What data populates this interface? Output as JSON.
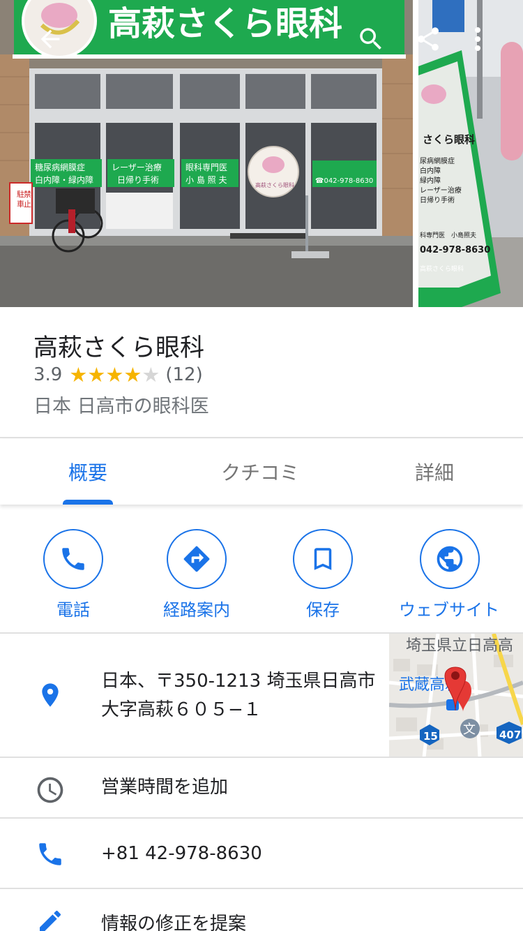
{
  "photos": {
    "main_sign": "高萩さくら眼科",
    "window_notes": [
      "糖尿病網膜症",
      "白内障・緑内障",
      "レーザー治療",
      "日帰り手術",
      "眼科専門医",
      "小 島 照 夫"
    ],
    "door_logo": "高萩さくら眼科",
    "window_phone": "☎042-978-8630",
    "no_parking": [
      "駐",
      "車",
      "禁",
      "止"
    ],
    "side_banner": {
      "title": "さくら眼科",
      "lines": [
        "尿病網膜症",
        "白内障",
        "緑内障",
        "レーザー治療",
        "日帰り手術"
      ],
      "doctor": "科専門医　小島照夫",
      "phone": "042-978-8630",
      "footer": "高萩さくら眼科"
    }
  },
  "place": {
    "name": "高萩さくら眼科",
    "rating": "3.9",
    "rating_fraction": 0.78,
    "review_count": "(12)",
    "category": "日本 日高市の眼科医"
  },
  "tabs": [
    {
      "label": "概要",
      "active": true
    },
    {
      "label": "クチコミ",
      "active": false
    },
    {
      "label": "詳細",
      "active": false
    }
  ],
  "actions": [
    {
      "label": "電話",
      "icon": "phone-icon"
    },
    {
      "label": "経路案内",
      "icon": "directions-icon"
    },
    {
      "label": "保存",
      "icon": "bookmark-icon"
    },
    {
      "label": "ウェブサイト",
      "icon": "globe-icon"
    }
  ],
  "details": {
    "address": "日本、〒350-1213 埼玉県日高市大字高萩６０５−１",
    "hours": "営業時間を追加",
    "phone": "+81 42-978-8630",
    "edit": "情報の修正を提案"
  },
  "map": {
    "label_top": "埼玉県立日高高",
    "label_station": "武蔵高萩",
    "route_15": "15",
    "route_407": "407",
    "school_mark": "文"
  },
  "colors": {
    "accent": "#1a73e8",
    "star": "#f6b400",
    "sign_green": "#1ea94f",
    "pin_red": "#e53935"
  }
}
